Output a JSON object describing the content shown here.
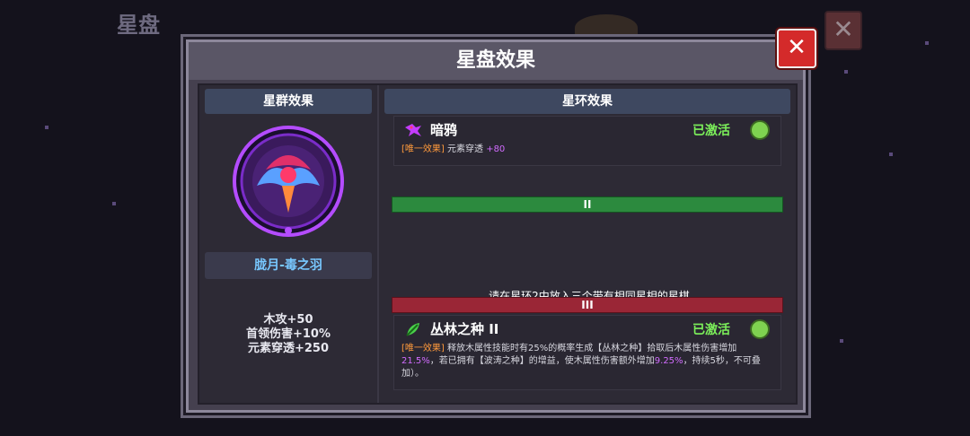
{
  "background": {
    "title": "星盘",
    "close_label": "✕"
  },
  "modal": {
    "title": "星盘效果",
    "close_label": "✕"
  },
  "left_panel": {
    "header": "星群效果",
    "emblem_icon": "crow-constellation-emblem",
    "constellation_name": "胧月-毒之羽",
    "stats": [
      "木攻+50",
      "首领伤害+10%",
      "元素穿透+250"
    ]
  },
  "right_panel": {
    "header": "星环效果",
    "ring1": {
      "icon": "crow-icon",
      "name": "暗鸦",
      "status": "已激活",
      "tag": "[唯一效果]",
      "effect": "元素穿透",
      "value": "+80"
    },
    "ring2": {
      "label": "II",
      "hint": "请在星环2中放入三个带有相同星相的星棋"
    },
    "ring3": {
      "label": "III",
      "icon": "jungle-seed-icon",
      "name": "丛林之种 II",
      "status": "已激活",
      "tag": "[唯一效果]",
      "desc_part1": "释放木属性技能时有25%的概率生成【丛林之种】拾取后木属性伤害增加",
      "value1": "21.5%",
      "desc_part2": "，若已拥有【波涛之种】的增益，使木属性伤害额外增加",
      "value2": "9.25%",
      "desc_part3": "，持续5秒，不可叠加）。"
    }
  },
  "colors": {
    "active_green": "#7cf05a",
    "effect_orange": "#ff9a3c",
    "value_purple": "#d26cff",
    "name_blue": "#78c8ff"
  }
}
